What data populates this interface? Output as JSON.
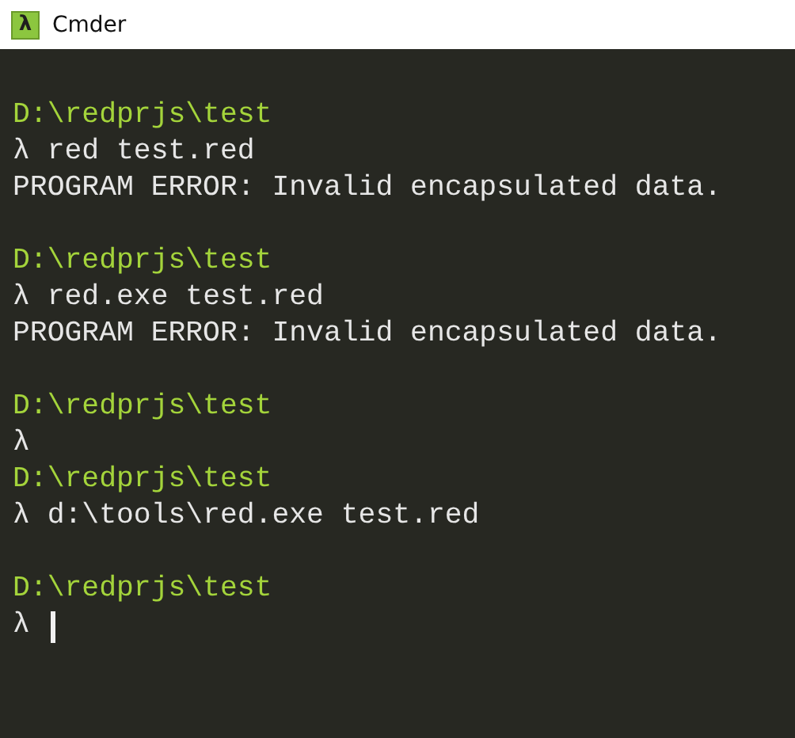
{
  "window": {
    "title": "Cmder",
    "icon_glyph": "λ"
  },
  "lines": [
    {
      "kind": "blank"
    },
    {
      "kind": "path",
      "text": "D:\\redprjs\\test"
    },
    {
      "kind": "prompt",
      "symbol": "λ",
      "command": "red test.red",
      "cursor": false
    },
    {
      "kind": "output",
      "text": "PROGRAM ERROR: Invalid encapsulated data."
    },
    {
      "kind": "blank"
    },
    {
      "kind": "path",
      "text": "D:\\redprjs\\test"
    },
    {
      "kind": "prompt",
      "symbol": "λ",
      "command": "red.exe test.red",
      "cursor": false
    },
    {
      "kind": "output",
      "text": "PROGRAM ERROR: Invalid encapsulated data."
    },
    {
      "kind": "blank"
    },
    {
      "kind": "path",
      "text": "D:\\redprjs\\test"
    },
    {
      "kind": "prompt",
      "symbol": "λ",
      "cursor": false
    },
    {
      "kind": "path",
      "text": "D:\\redprjs\\test"
    },
    {
      "kind": "prompt",
      "symbol": "λ",
      "command": "d:\\tools\\red.exe test.red",
      "cursor": false
    },
    {
      "kind": "blank"
    },
    {
      "kind": "path",
      "text": "D:\\redprjs\\test"
    },
    {
      "kind": "prompt",
      "symbol": "λ",
      "cursor": true
    }
  ]
}
